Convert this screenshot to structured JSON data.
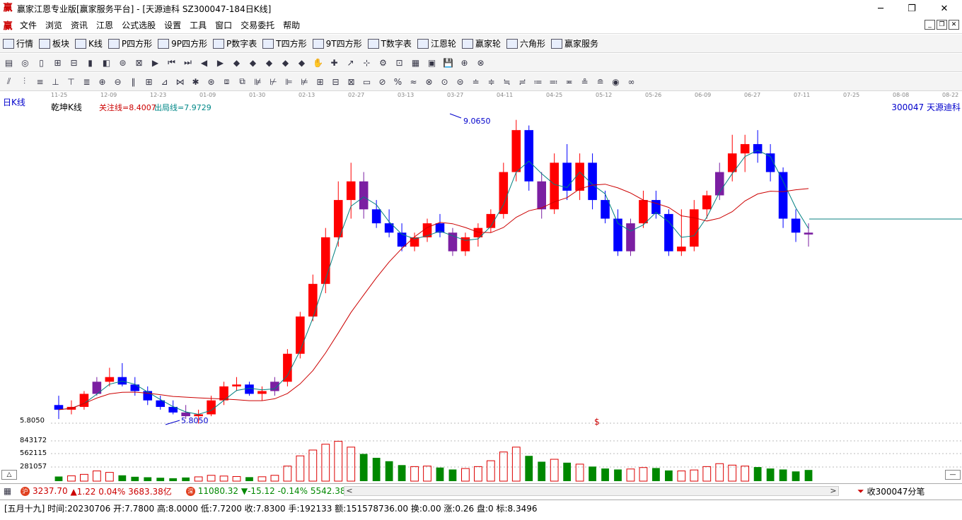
{
  "window": {
    "title": "赢家江恩专业版[赢家服务平台] - [天源迪科  SZ300047-184日K线]",
    "minimize": "─",
    "restore": "❐",
    "close": "✕"
  },
  "menu": [
    "文件",
    "浏览",
    "资讯",
    "江恩",
    "公式选股",
    "设置",
    "工具",
    "窗口",
    "交易委托",
    "帮助"
  ],
  "toolbar1": [
    {
      "icon": "table-icon",
      "label": "行情"
    },
    {
      "icon": "block-icon",
      "label": "板块"
    },
    {
      "icon": "kline-icon",
      "label": "K线"
    },
    {
      "icon": "ps-icon",
      "label": "P四方形"
    },
    {
      "icon": "p9-icon",
      "label": "9P四方形"
    },
    {
      "icon": "pn-icon",
      "label": "P数字表"
    },
    {
      "icon": "ts-icon",
      "label": "T四方形"
    },
    {
      "icon": "t9-icon",
      "label": "9T四方形"
    },
    {
      "icon": "tn-icon",
      "label": "T数字表"
    },
    {
      "icon": "gann-wheel-icon",
      "label": "江恩轮"
    },
    {
      "icon": "winner-wheel-icon",
      "label": "赢家轮"
    },
    {
      "icon": "hexagon-icon",
      "label": "六角形"
    },
    {
      "icon": "service-icon",
      "label": "赢家服务"
    }
  ],
  "chart": {
    "period": "日K线",
    "indicator": "乾坤K线",
    "focus_line": "关注线=8.4007",
    "exit_line": "出局线=7.9729",
    "stock": "300047  天源迪科",
    "price_high": "9.0650",
    "price_low": "5.8050",
    "dollar_mark": "$",
    "vol_ticks": [
      "5.8050",
      "843172",
      "562115",
      "281057"
    ],
    "dates": [
      "11-25",
      "12-09",
      "12-23",
      "01-09",
      "01-30",
      "02-13",
      "02-27",
      "03-13",
      "03-27",
      "04-11",
      "04-25",
      "05-12",
      "05-26",
      "06-09",
      "06-27",
      "07-11",
      "07-25",
      "08-08",
      "08-22"
    ],
    "colors": {
      "up": "#ff0000",
      "down": "#0000ff",
      "neutral": "#7b1fa2",
      "ma_long": "#cc0000",
      "ma_short": "#008080",
      "vol_up": "#dd0000",
      "vol_down": "#008800"
    }
  },
  "chart_data": {
    "type": "candlestick",
    "title": "天源迪科 日K线",
    "ylim": [
      5.805,
      9.065
    ],
    "annotations": [
      "9.0650",
      "5.8050"
    ],
    "candles_open_high_low_close": [
      [
        6.0,
        6.1,
        5.85,
        5.95
      ],
      [
        5.95,
        6.05,
        5.9,
        5.98
      ],
      [
        5.98,
        6.15,
        5.95,
        6.12
      ],
      [
        6.12,
        6.3,
        6.1,
        6.25
      ],
      [
        6.25,
        6.4,
        6.2,
        6.3
      ],
      [
        6.3,
        6.45,
        6.2,
        6.22
      ],
      [
        6.22,
        6.3,
        6.1,
        6.15
      ],
      [
        6.15,
        6.2,
        6.0,
        6.05
      ],
      [
        6.05,
        6.1,
        5.95,
        5.98
      ],
      [
        5.98,
        6.05,
        5.9,
        5.92
      ],
      [
        5.92,
        6.0,
        5.85,
        5.88
      ],
      [
        5.88,
        5.95,
        5.8,
        5.9
      ],
      [
        5.9,
        6.1,
        5.88,
        6.05
      ],
      [
        6.05,
        6.25,
        6.0,
        6.2
      ],
      [
        6.2,
        6.3,
        6.15,
        6.22
      ],
      [
        6.22,
        6.25,
        6.1,
        6.12
      ],
      [
        6.12,
        6.2,
        6.05,
        6.15
      ],
      [
        6.15,
        6.3,
        6.1,
        6.25
      ],
      [
        6.25,
        6.6,
        6.2,
        6.55
      ],
      [
        6.55,
        7.0,
        6.5,
        6.95
      ],
      [
        6.95,
        7.4,
        6.9,
        7.3
      ],
      [
        7.3,
        7.9,
        7.2,
        7.8
      ],
      [
        7.8,
        8.4,
        7.7,
        8.2
      ],
      [
        8.2,
        8.6,
        8.0,
        8.4
      ],
      [
        8.4,
        8.5,
        8.0,
        8.1
      ],
      [
        8.1,
        8.2,
        7.9,
        7.95
      ],
      [
        7.95,
        8.1,
        7.8,
        7.85
      ],
      [
        7.85,
        7.95,
        7.65,
        7.7
      ],
      [
        7.7,
        7.85,
        7.65,
        7.8
      ],
      [
        7.8,
        8.0,
        7.75,
        7.95
      ],
      [
        7.95,
        8.05,
        7.8,
        7.85
      ],
      [
        7.85,
        7.9,
        7.6,
        7.65
      ],
      [
        7.65,
        7.85,
        7.6,
        7.8
      ],
      [
        7.8,
        7.95,
        7.7,
        7.9
      ],
      [
        7.9,
        8.1,
        7.85,
        8.05
      ],
      [
        8.05,
        8.6,
        8.0,
        8.5
      ],
      [
        8.5,
        9.06,
        8.4,
        8.95
      ],
      [
        8.95,
        9.0,
        8.3,
        8.4
      ],
      [
        8.4,
        8.5,
        8.0,
        8.1
      ],
      [
        8.1,
        8.7,
        8.05,
        8.6
      ],
      [
        8.6,
        8.8,
        8.2,
        8.3
      ],
      [
        8.3,
        8.7,
        8.2,
        8.6
      ],
      [
        8.6,
        8.7,
        8.1,
        8.2
      ],
      [
        8.2,
        8.3,
        7.95,
        8.0
      ],
      [
        8.0,
        8.1,
        7.6,
        7.65
      ],
      [
        7.65,
        8.0,
        7.6,
        7.95
      ],
      [
        7.95,
        8.3,
        7.9,
        8.2
      ],
      [
        8.2,
        8.3,
        8.0,
        8.05
      ],
      [
        8.05,
        8.1,
        7.6,
        7.65
      ],
      [
        7.65,
        8.1,
        7.6,
        7.7
      ],
      [
        7.7,
        8.2,
        7.65,
        8.1
      ],
      [
        8.1,
        8.3,
        8.0,
        8.25
      ],
      [
        8.25,
        8.6,
        8.2,
        8.5
      ],
      [
        8.5,
        8.9,
        8.4,
        8.7
      ],
      [
        8.7,
        8.9,
        8.5,
        8.8
      ],
      [
        8.8,
        8.95,
        8.6,
        8.7
      ],
      [
        8.7,
        8.8,
        8.4,
        8.5
      ],
      [
        8.5,
        8.55,
        7.9,
        8.0
      ],
      [
        8.0,
        8.1,
        7.75,
        7.85
      ],
      [
        7.85,
        7.95,
        7.7,
        7.83
      ]
    ],
    "volume": [
      95000,
      110000,
      140000,
      210000,
      180000,
      120000,
      90000,
      80000,
      70000,
      60000,
      75000,
      88000,
      120000,
      105000,
      95000,
      82000,
      90000,
      120000,
      310000,
      520000,
      640000,
      760000,
      820000,
      700000,
      560000,
      480000,
      410000,
      330000,
      300000,
      310000,
      280000,
      240000,
      260000,
      300000,
      420000,
      600000,
      700000,
      520000,
      400000,
      450000,
      380000,
      350000,
      300000,
      260000,
      240000,
      250000,
      280000,
      270000,
      220000,
      210000,
      230000,
      300000,
      360000,
      330000,
      310000,
      290000,
      260000,
      240000,
      200000,
      230000
    ]
  },
  "statusbar1": {
    "sh_index": "3237.70",
    "sh_change": "▲1.22 0.04% 3683.38亿",
    "sz_index": "11080.32",
    "sz_change": "▼-15.12 -0.14% 5542.38",
    "scroll_left": "<",
    "scroll_right": ">",
    "collect": "收300047分笔"
  },
  "statusbar2": {
    "info": "[五月十九] 时间:20230706 开:7.7800 高:8.0000 低:7.7200 收:7.8300 手:192133 额:151578736.00 换:0.00 涨:0.26 盘:0 标:8.3496"
  }
}
